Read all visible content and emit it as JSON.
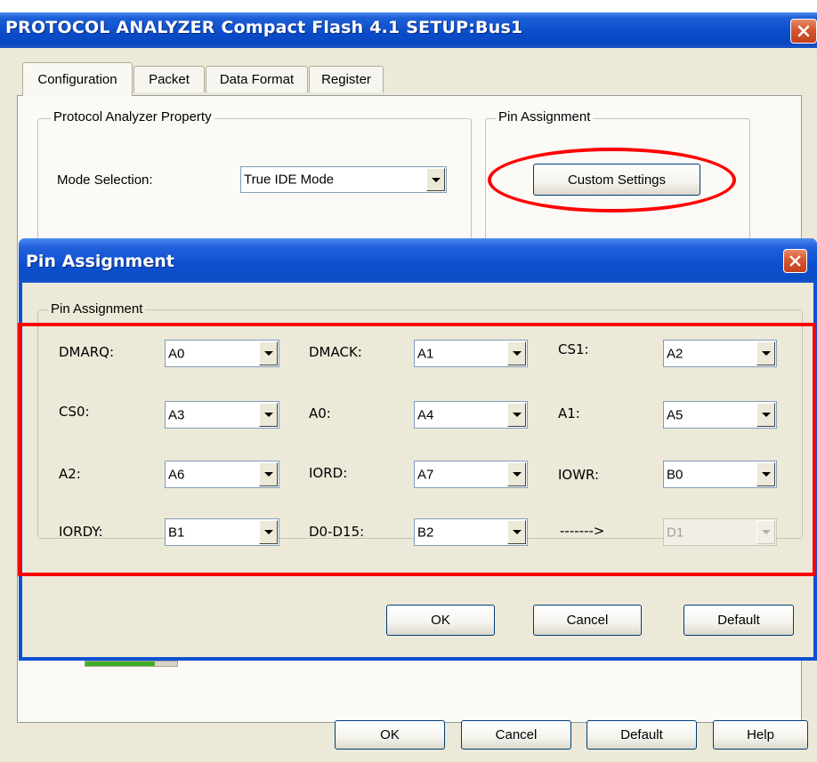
{
  "main_window": {
    "title": "PROTOCOL ANALYZER Compact Flash 4.1 SETUP:Bus1",
    "tabs": [
      "Configuration",
      "Packet",
      "Data Format",
      "Register"
    ],
    "protocol_group": {
      "title": "Protocol Analyzer Property",
      "mode_label": "Mode Selection:",
      "mode_value": "True IDE Mode"
    },
    "pin_group": {
      "title": "Pin Assignment",
      "button": "Custom Settings"
    },
    "buttons": {
      "ok": "OK",
      "cancel": "Cancel",
      "default": "Default",
      "help": "Help"
    }
  },
  "dialog": {
    "title": "Pin Assignment",
    "group_title": "Pin Assignment",
    "pins": [
      {
        "label": "DMARQ:",
        "value": "A0",
        "disabled": false
      },
      {
        "label": "DMACK:",
        "value": "A1",
        "disabled": false
      },
      {
        "label": "CS1:",
        "value": "A2",
        "disabled": false
      },
      {
        "label": "CS0:",
        "value": "A3",
        "disabled": false
      },
      {
        "label": "A0:",
        "value": "A4",
        "disabled": false
      },
      {
        "label": "A1:",
        "value": "A5",
        "disabled": false
      },
      {
        "label": "A2:",
        "value": "A6",
        "disabled": false
      },
      {
        "label": "IORD:",
        "value": "A7",
        "disabled": false
      },
      {
        "label": "IOWR:",
        "value": "B0",
        "disabled": false
      },
      {
        "label": "IORDY:",
        "value": "B1",
        "disabled": false
      },
      {
        "label": "D0-D15:",
        "value": "B2",
        "disabled": false
      },
      {
        "label": "------->",
        "value": "D1",
        "disabled": true
      }
    ],
    "buttons": {
      "ok": "OK",
      "cancel": "Cancel",
      "default": "Default"
    }
  },
  "annotations": {
    "highlight_color": "#ff0000"
  }
}
